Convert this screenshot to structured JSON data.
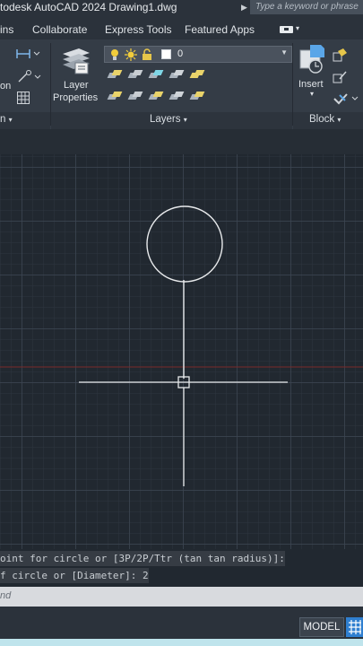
{
  "window": {
    "title": "todesk AutoCAD 2024   Drawing1.dwg",
    "search_placeholder": "Type a keyword or phrase"
  },
  "ribbon_tabs": [
    "ins",
    "Collaborate",
    "Express Tools",
    "Featured Apps"
  ],
  "ribbon": {
    "left_label_on": "on",
    "layer_properties_line1": "Layer",
    "layer_properties_line2": "Properties",
    "layer_combo_value": "0",
    "insert_label": "Insert",
    "panels": {
      "layers": "Layers",
      "block": "Block",
      "left_partial_arrow": "n"
    }
  },
  "command_history": [
    "oint for circle or [3P/2P/Ttr (tan tan radius)]:",
    "f circle or [Diameter]: 2"
  ],
  "command_input_placeholder": "nd",
  "status": {
    "model_label": "MODEL"
  },
  "colors": {
    "canvas_bg": "#212830",
    "ribbon_bg": "#343c46",
    "accent": "#2f7fd0",
    "x_axis": "#8a2f2f",
    "geometry": "#e8eaec"
  }
}
